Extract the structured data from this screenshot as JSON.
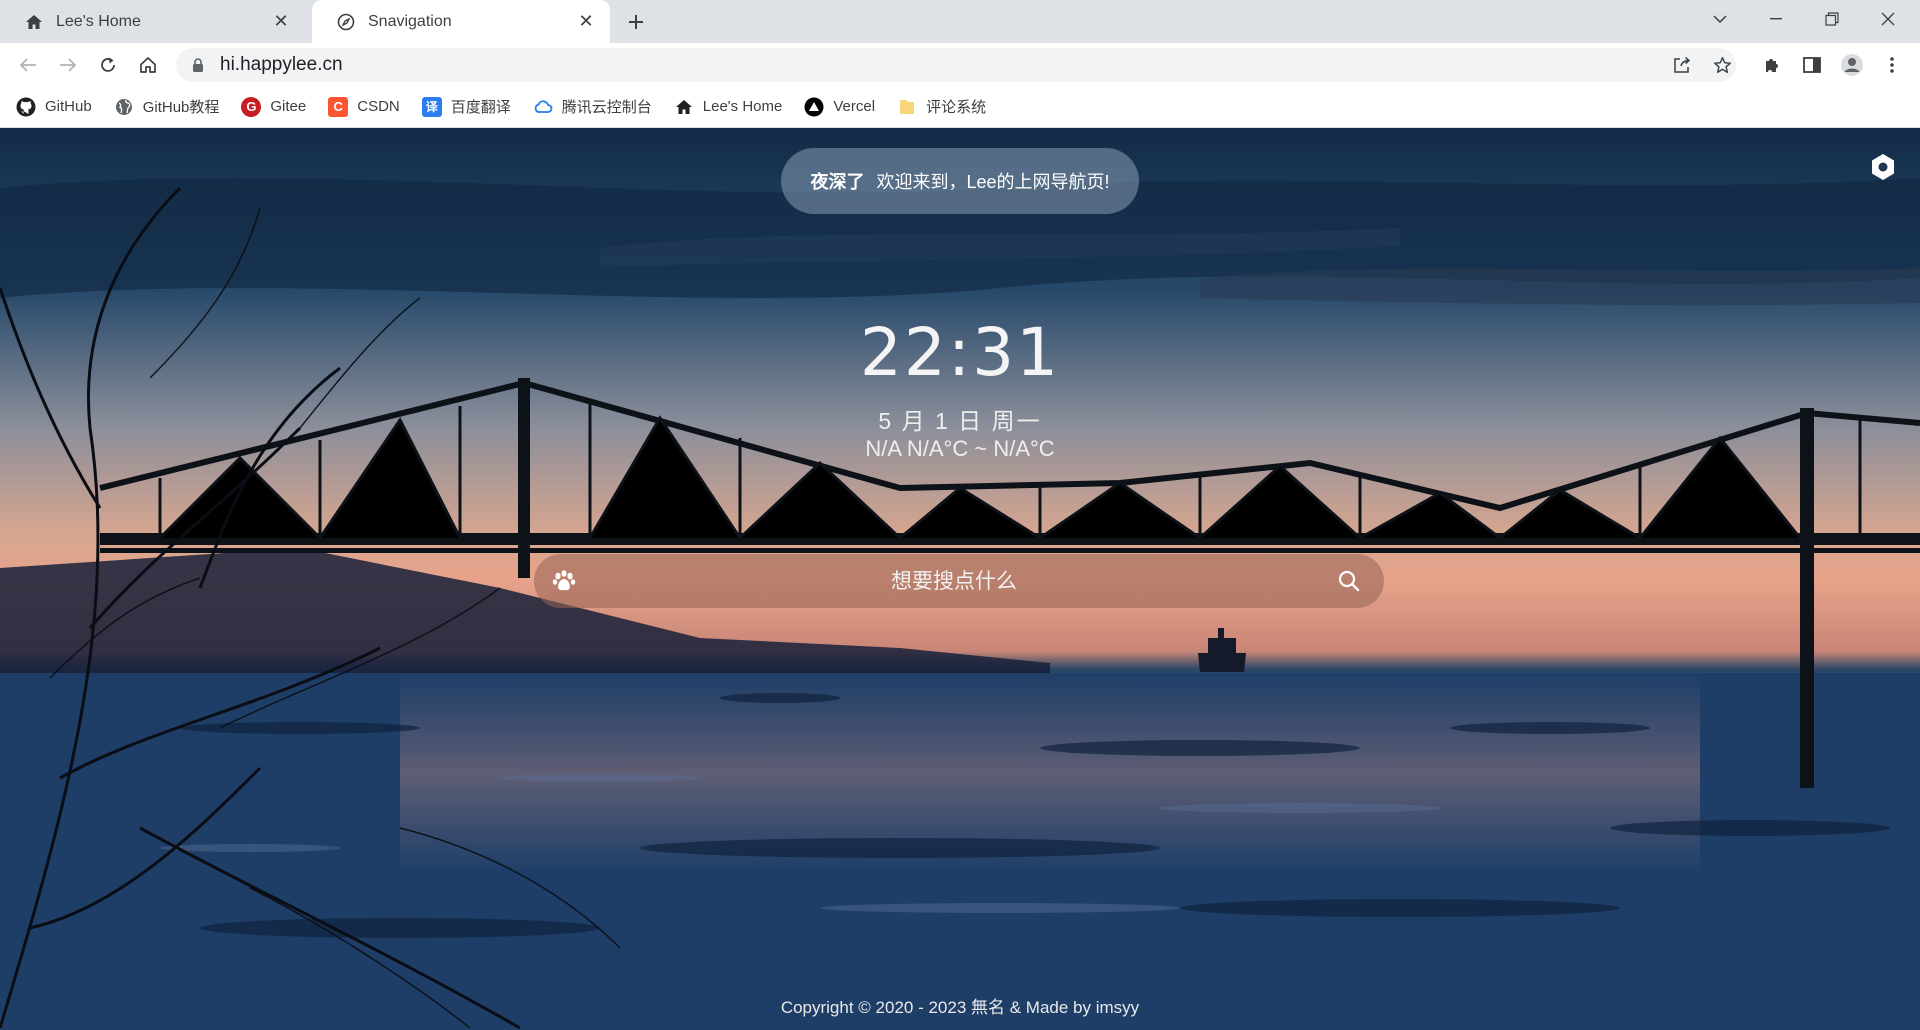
{
  "browser": {
    "tabs": [
      {
        "title": "Lee's Home",
        "icon": "home-icon",
        "active": false
      },
      {
        "title": "Snavigation",
        "icon": "compass-icon",
        "active": true
      }
    ],
    "url": "hi.happylee.cn"
  },
  "bookmarks": [
    {
      "label": "GitHub",
      "icon": "github-icon"
    },
    {
      "label": "GitHub教程",
      "icon": "globe-icon"
    },
    {
      "label": "Gitee",
      "icon": "gitee-icon",
      "color": "#c71d23",
      "glyph": "G"
    },
    {
      "label": "CSDN",
      "icon": "csdn-icon",
      "color": "#fc5531",
      "glyph": "C"
    },
    {
      "label": "百度翻译",
      "icon": "baidu-translate-icon",
      "color": "#2b7df0",
      "glyph": "译"
    },
    {
      "label": "腾讯云控制台",
      "icon": "tencent-cloud-icon"
    },
    {
      "label": "Lee's Home",
      "icon": "home-icon"
    },
    {
      "label": "Vercel",
      "icon": "vercel-icon"
    },
    {
      "label": "评论系统",
      "icon": "folder-icon"
    }
  ],
  "page": {
    "greeting": "夜深了",
    "welcome": "欢迎来到，Lee的上网导航页!",
    "time": "22:31",
    "date": "5 月 1 日 周一",
    "weather": "N/A N/A°C ~ N/A°C",
    "search_placeholder": "想要搜点什么",
    "footer": "Copyright © 2020 - 2023 無名 &  Made by imsyy"
  },
  "colors": {
    "chrome_bg": "#dee1e6",
    "omnibox_bg": "#f1f3f4",
    "text": "#3c4043"
  }
}
